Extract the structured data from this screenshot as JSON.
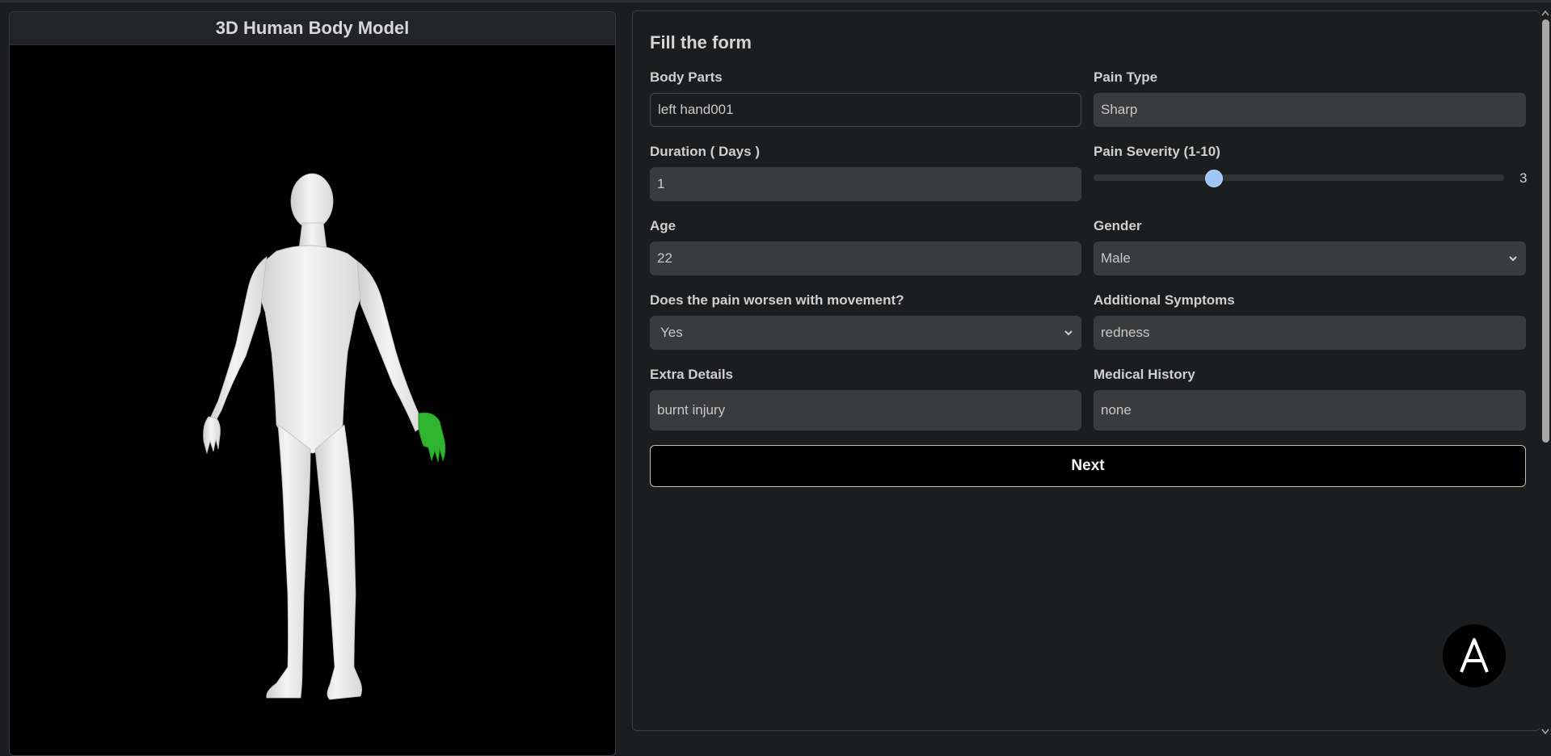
{
  "viewer": {
    "title": "3D Human Body Model"
  },
  "form": {
    "title": "Fill the form",
    "body_parts": {
      "label": "Body Parts",
      "value": "left hand001"
    },
    "pain_type": {
      "label": "Pain Type",
      "value": "Sharp"
    },
    "duration": {
      "label": "Duration ( Days )",
      "value": "1"
    },
    "pain_severity": {
      "label": "Pain Severity (1-10)",
      "value": "3",
      "min": 1,
      "max": 10
    },
    "age": {
      "label": "Age",
      "value": "22"
    },
    "gender": {
      "label": "Gender",
      "value": "Male"
    },
    "movement": {
      "label": "Does the pain worsen with movement?",
      "value": "Yes"
    },
    "additional_symptoms": {
      "label": "Additional Symptoms",
      "value": "redness"
    },
    "extra_details": {
      "label": "Extra Details",
      "value": "burnt injury"
    },
    "medical_history": {
      "label": "Medical History",
      "value": "none"
    },
    "next_label": "Next"
  },
  "fab": {
    "glyph": "A"
  },
  "colors": {
    "highlight": "#2fb52f",
    "slider_thumb": "#9ec7f5",
    "background": "#1c1d1f",
    "field": "#3a3b3d"
  }
}
